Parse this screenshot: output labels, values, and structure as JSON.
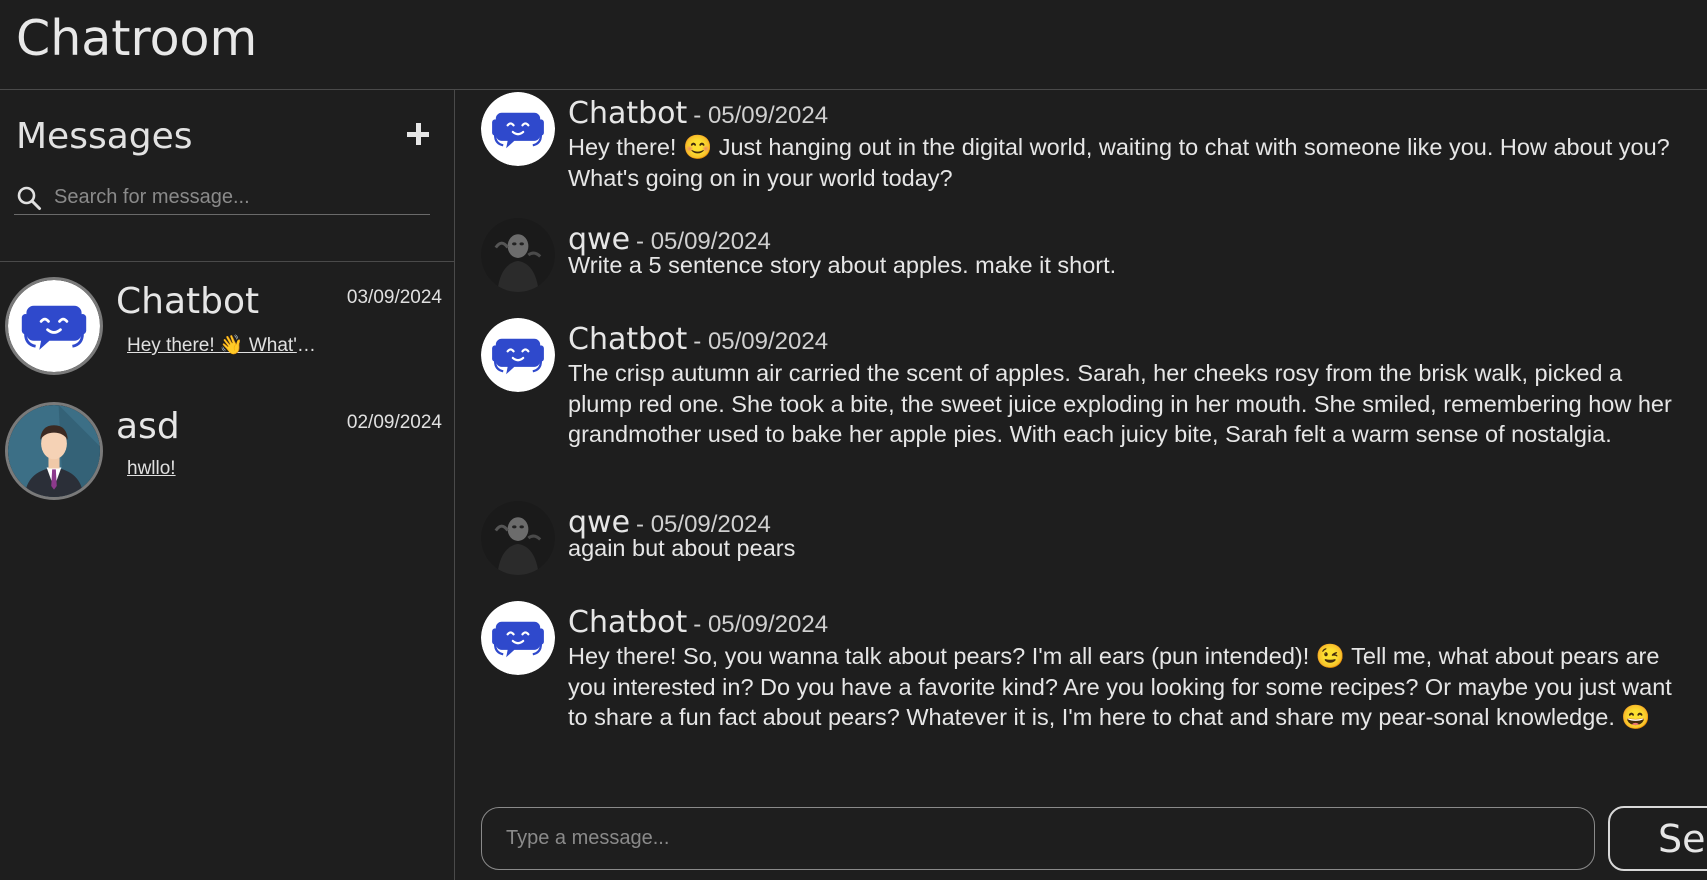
{
  "app": {
    "title": "Chatroom"
  },
  "sidebar": {
    "heading": "Messages",
    "new_icon": "plus-icon",
    "search": {
      "icon": "search-icon",
      "placeholder": "Search for message..."
    },
    "conversations": [
      {
        "name": "Chatbot",
        "date": "03/09/2024",
        "preview": "Hey there! 👋 What's up?",
        "avatar": "robot-avatar"
      },
      {
        "name": "asd",
        "date": "02/09/2024",
        "preview": "hwllo!",
        "avatar": "businessman-avatar"
      }
    ]
  },
  "chat": {
    "messages": [
      {
        "sender": "Chatbot",
        "date": "- 05/09/2024",
        "avatar": "robot-avatar",
        "text": "Hey there! 😊 Just hanging out in the digital world, waiting to chat with someone like you. How about you? What's going on in your world today?"
      },
      {
        "sender": "qwe",
        "date": "- 05/09/2024",
        "avatar": "dark-figure-avatar",
        "text": "Write a 5 sentence story about apples. make it short."
      },
      {
        "sender": "Chatbot",
        "date": "- 05/09/2024",
        "avatar": "robot-avatar",
        "text": "The crisp autumn air carried the scent of apples. Sarah, her cheeks rosy from the brisk walk, picked a plump red one. She took a bite, the sweet juice exploding in her mouth. She smiled, remembering how her grandmother used to bake her apple pies. With each juicy bite, Sarah felt a warm sense of nostalgia."
      },
      {
        "sender": "qwe",
        "date": "- 05/09/2024",
        "avatar": "dark-figure-avatar",
        "text": "again but about pears"
      },
      {
        "sender": "Chatbot",
        "date": "- 05/09/2024",
        "avatar": "robot-avatar",
        "text": "Hey there! So, you wanna talk about pears? I'm all ears (pun intended)! 😉 Tell me, what about pears are you interested in? Do you have a favorite kind? Are you looking for some recipes? Or maybe you just want to share a fun fact about pears? Whatever it is, I'm here to chat and share my pear-sonal knowledge. 😄"
      }
    ],
    "composer": {
      "placeholder": "Type a message...",
      "value": ""
    },
    "send_label": "Send"
  },
  "colors": {
    "background": "#1e1e1e",
    "divider": "#4a4a4a",
    "robot_blue": "#2f49cc",
    "text": "#e6e6e6"
  }
}
